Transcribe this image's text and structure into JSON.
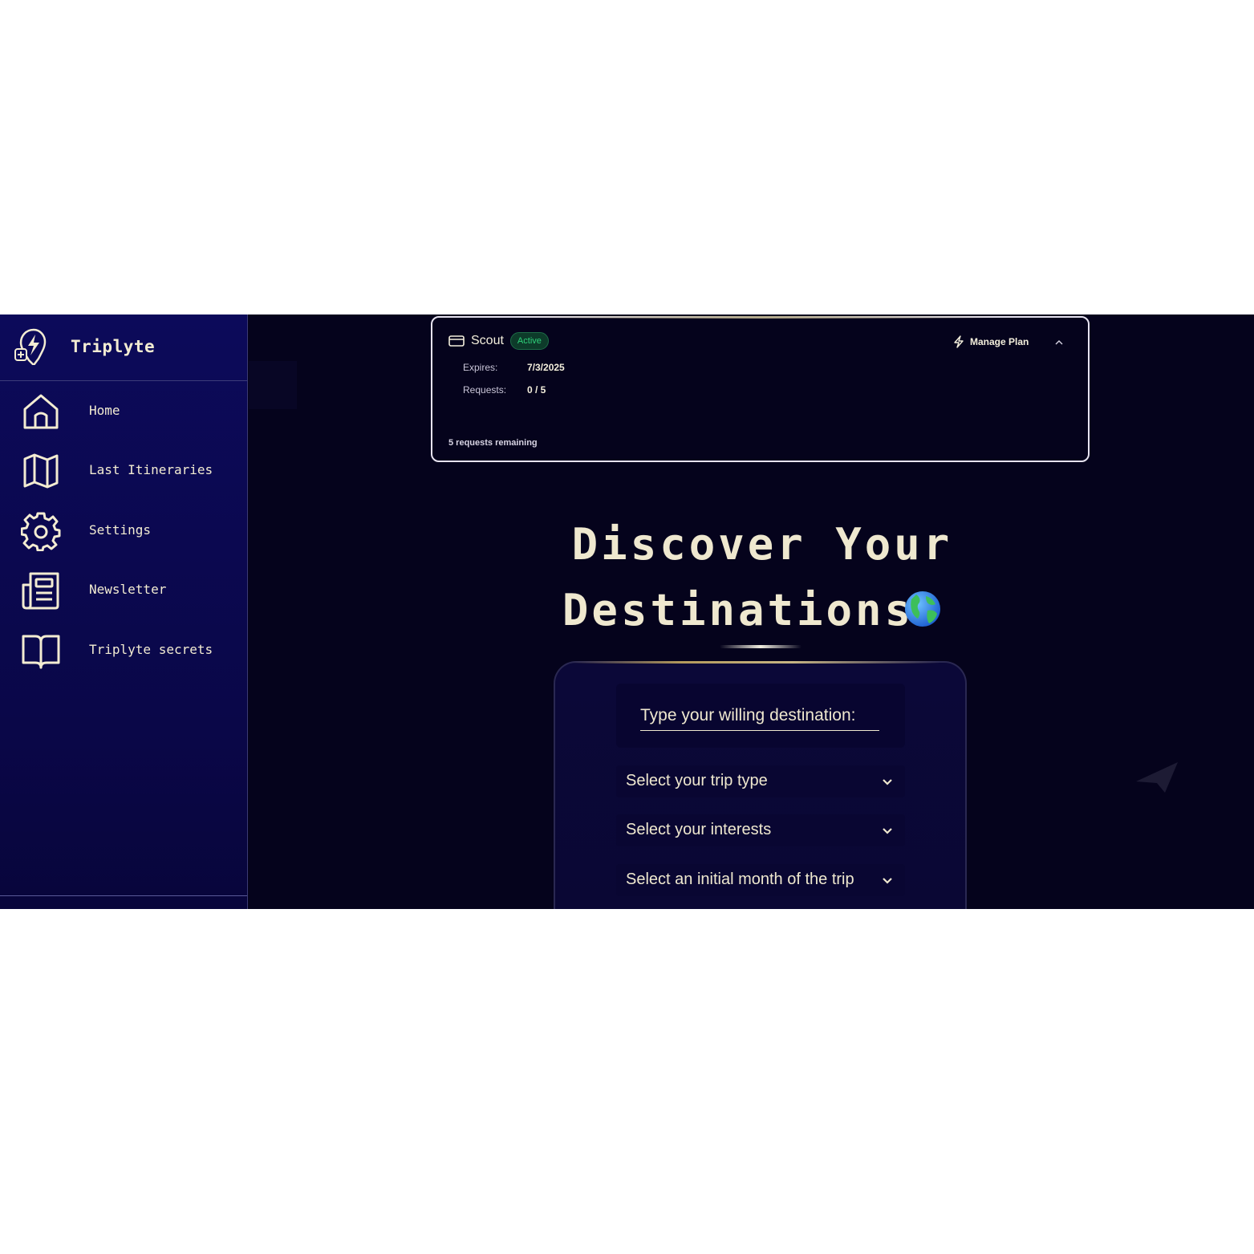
{
  "brand": {
    "name": "Triplyte",
    "logo_icon": "lightning-pin-logo"
  },
  "sidebar": {
    "items": [
      {
        "label": "Home",
        "icon": "home-icon"
      },
      {
        "label": "Last Itineraries",
        "icon": "map-icon"
      },
      {
        "label": "Settings",
        "icon": "gear-icon"
      },
      {
        "label": "Newsletter",
        "icon": "newspaper-icon"
      },
      {
        "label": "Triplyte secrets",
        "icon": "book-icon"
      }
    ]
  },
  "plan": {
    "name": "Scout",
    "status": "Active",
    "expires_label": "Expires:",
    "expires_value": "7/3/2025",
    "requests_label": "Requests:",
    "requests_value": "0 / 5",
    "remaining": "5 requests remaining",
    "manage_label": "Manage Plan"
  },
  "main": {
    "heading_line1": "Discover Your",
    "heading_line2": "Destinations",
    "destination_placeholder": "Type your willing destination:",
    "selects": [
      {
        "label": "Select your trip type"
      },
      {
        "label": "Select your interests"
      },
      {
        "label": "Select an initial month of the trip"
      }
    ]
  },
  "colors": {
    "sidebar_bg": "#0c0a5a",
    "main_bg": "#05031c",
    "text_cream": "#efe8cf",
    "active_green": "#2fd17a"
  }
}
